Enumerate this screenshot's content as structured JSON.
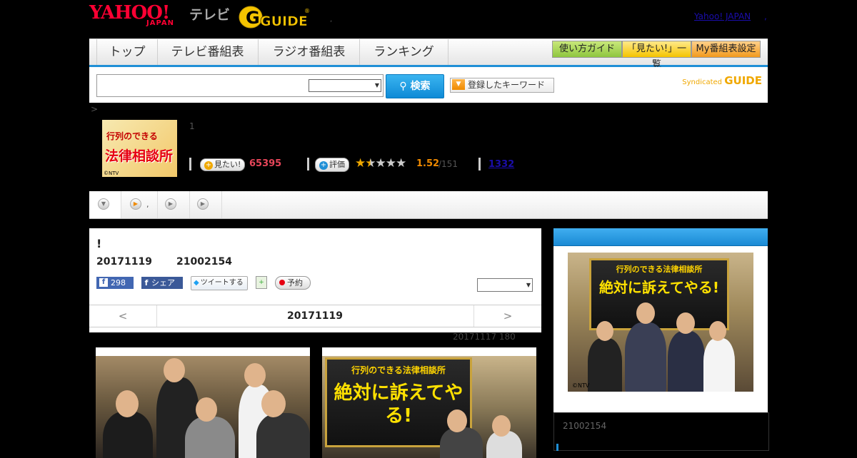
{
  "header": {
    "yahoo_logo": "YAHOO!",
    "yahoo_logo_sub": "JAPAN",
    "tv_label": "テレビ",
    "gguide_logo": "G-GUIDE",
    "dot": ",",
    "yahoo_japan_link": "Yahoo! JAPAN",
    "link_sep": ","
  },
  "nav": {
    "tabs": [
      "トップ",
      "テレビ番組表",
      "ラジオ番組表",
      "ランキング"
    ],
    "buttons": [
      "使い方ガイド",
      "「見たい!」一覧",
      "My番組表設定"
    ]
  },
  "search": {
    "input_value": "",
    "button_label": "検索",
    "keyword_button": "登録したキーワード",
    "syndicated_label": "Syndicated",
    "syndicated_brand": "GUIDE"
  },
  "breadcrumb": ">",
  "program": {
    "image_text_top": "行列のできる",
    "image_text_main": "法律相談所",
    "image_copyright": "©NTV",
    "count": "1",
    "mitai_label": "見たい!",
    "mitai_count": "65395",
    "rating_label": "評価",
    "rating_value": "1.52",
    "rating_count": "/151",
    "review_count": "1332",
    "rating": 1.52,
    "rating_max": 5
  },
  "subnav": {
    "tab2_label": ","
  },
  "episode": {
    "title": "!",
    "date": "20171119",
    "time": "21002154",
    "fb_like_count": "298",
    "fb_share_label": "シェア",
    "tweet_label": "ツイートする",
    "reserve_label": "予約",
    "select_value": "",
    "nav_prev": "<",
    "nav_date": "20171119",
    "nav_next": ">",
    "meta": "20171117  180"
  },
  "photos": {
    "sign_top": "行列のできる法律相談所",
    "sign_main": "絶対に訴えてやる!"
  },
  "sidebar": {
    "photo_copyright": "©NTV",
    "photo_sign_top": "行列のできる法律相談所",
    "photo_sign_main": "絶対に訴えてやる!",
    "air_time": "21002154"
  },
  "colors": {
    "accent_blue": "#1f8fd6",
    "mitai_pink": "#e8465a",
    "rating_orange": "#f08a00",
    "brand_red": "#ff0033"
  }
}
